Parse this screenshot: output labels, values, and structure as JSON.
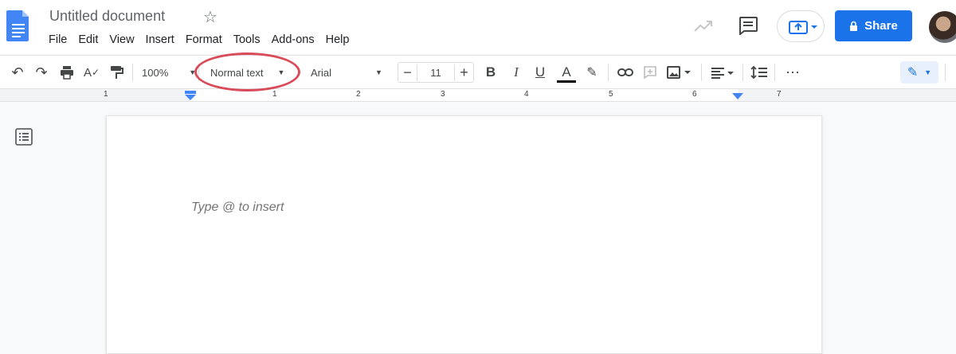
{
  "document": {
    "title": "Untitled document"
  },
  "menu": [
    "File",
    "Edit",
    "View",
    "Insert",
    "Format",
    "Tools",
    "Add-ons",
    "Help"
  ],
  "header": {
    "share_label": "Share"
  },
  "toolbar": {
    "zoom": "100%",
    "style": "Normal text",
    "font": "Arial",
    "font_size": "11"
  },
  "ruler": {
    "numbers": [
      "1",
      "1",
      "2",
      "3",
      "4",
      "5",
      "6",
      "7"
    ]
  },
  "page": {
    "placeholder": "Type @ to insert"
  },
  "colors": {
    "accent": "#1a73e8",
    "highlight_ring": "#d94b58"
  }
}
